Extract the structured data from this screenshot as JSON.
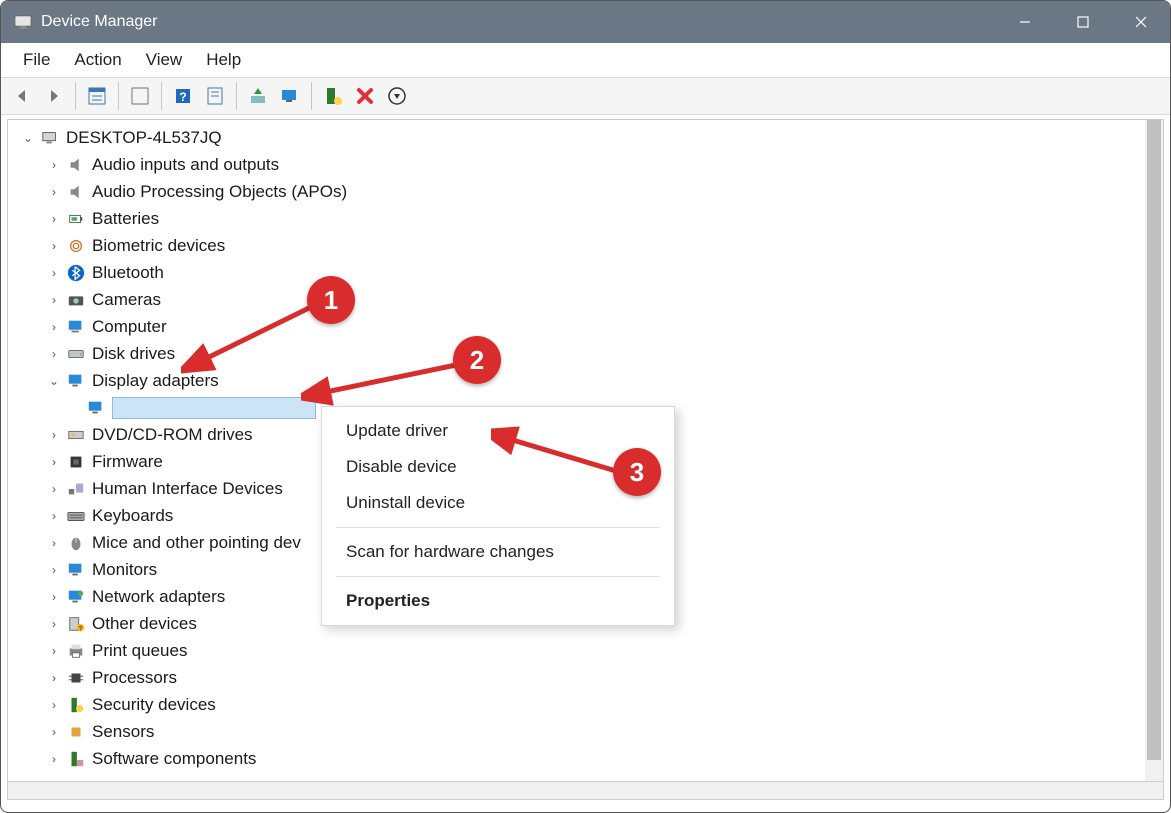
{
  "title": "Device Manager",
  "menu": {
    "file": "File",
    "action": "Action",
    "view": "View",
    "help": "Help"
  },
  "root": {
    "label": "DESKTOP-4L537JQ"
  },
  "categories": [
    {
      "icon": "audio-icon",
      "label": "Audio inputs and outputs"
    },
    {
      "icon": "audio-icon",
      "label": "Audio Processing Objects (APOs)"
    },
    {
      "icon": "battery-icon",
      "label": "Batteries"
    },
    {
      "icon": "fingerprint-icon",
      "label": "Biometric devices"
    },
    {
      "icon": "bluetooth-icon",
      "label": "Bluetooth"
    },
    {
      "icon": "camera-icon",
      "label": "Cameras"
    },
    {
      "icon": "computer-icon",
      "label": "Computer"
    },
    {
      "icon": "disk-icon",
      "label": "Disk drives"
    },
    {
      "icon": "display-icon",
      "label": "Display adapters",
      "expanded": true
    },
    {
      "icon": "dvd-icon",
      "label": "DVD/CD-ROM drives"
    },
    {
      "icon": "firmware-icon",
      "label": "Firmware"
    },
    {
      "icon": "hid-icon",
      "label": "Human Interface Devices"
    },
    {
      "icon": "keyboard-icon",
      "label": "Keyboards"
    },
    {
      "icon": "mouse-icon",
      "label": "Mice and other pointing dev"
    },
    {
      "icon": "monitor-icon",
      "label": "Monitors"
    },
    {
      "icon": "network-icon",
      "label": "Network adapters"
    },
    {
      "icon": "other-icon",
      "label": "Other devices"
    },
    {
      "icon": "printer-icon",
      "label": "Print queues"
    },
    {
      "icon": "cpu-icon",
      "label": "Processors"
    },
    {
      "icon": "security-icon",
      "label": "Security devices"
    },
    {
      "icon": "sensor-icon",
      "label": "Sensors"
    },
    {
      "icon": "software-icon",
      "label": "Software components"
    }
  ],
  "context_menu": {
    "update": "Update driver",
    "disable": "Disable device",
    "uninstall": "Uninstall device",
    "scan": "Scan for hardware changes",
    "properties": "Properties"
  },
  "annotations": {
    "b1": "1",
    "b2": "2",
    "b3": "3"
  }
}
